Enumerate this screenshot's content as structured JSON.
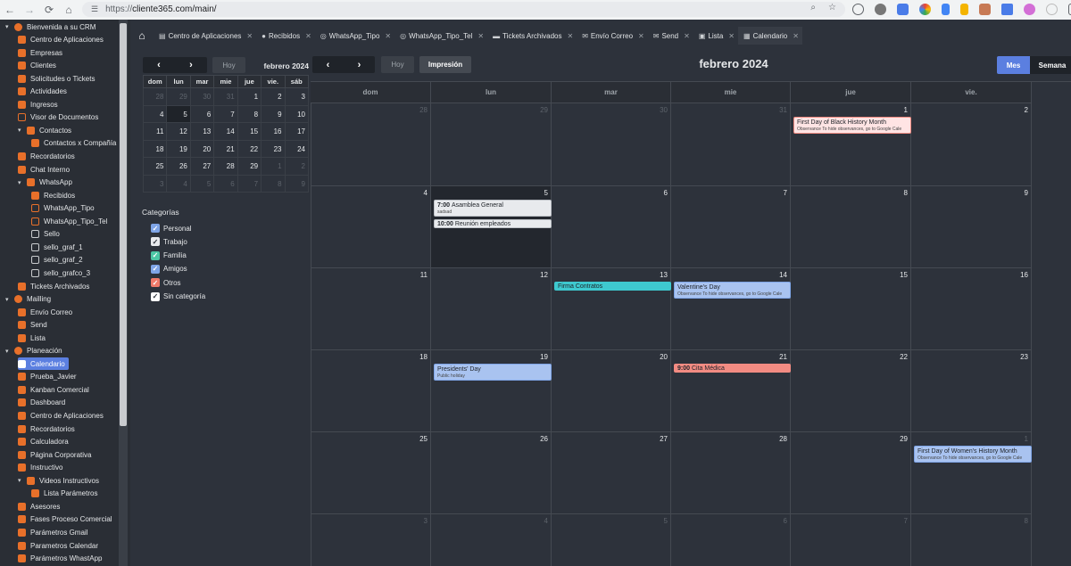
{
  "browser": {
    "url_scheme": "https://",
    "url_host": "cliente365.com/main/"
  },
  "sidebar": {
    "items": [
      {
        "label": "Bienvenida a su CRM",
        "level": 0,
        "icon": "shield-icon",
        "caret": "▾"
      },
      {
        "label": "Centro de Aplicaciones",
        "level": 1,
        "icon": "apps-icon"
      },
      {
        "label": "Empresas",
        "level": 1,
        "icon": "building-icon"
      },
      {
        "label": "Clientes",
        "level": 1,
        "icon": "users-icon"
      },
      {
        "label": "Solicitudes o Tickets",
        "level": 1,
        "icon": "ticket-icon"
      },
      {
        "label": "Actividades",
        "level": 1,
        "icon": "activity-icon"
      },
      {
        "label": "Ingresos",
        "level": 1,
        "icon": "income-icon"
      },
      {
        "label": "Visor de Documentos",
        "level": 1,
        "icon": "document-icon"
      },
      {
        "label": "Contactos",
        "level": 1,
        "icon": "contacts-icon",
        "caret": "▾"
      },
      {
        "label": "Contactos x Compañía",
        "level": 2,
        "icon": "contacts-icon"
      },
      {
        "label": "Recordatorios",
        "level": 1,
        "icon": "reminder-icon"
      },
      {
        "label": "Chat Interno",
        "level": 1,
        "icon": "chat-icon"
      },
      {
        "label": "WhatsApp",
        "level": 1,
        "icon": "whatsapp-icon",
        "caret": "▾"
      },
      {
        "label": "Recibidos",
        "level": 2,
        "icon": "inbox-icon"
      },
      {
        "label": "WhatsApp_Tipo",
        "level": 2,
        "icon": "form-icon"
      },
      {
        "label": "WhatsApp_Tipo_Tel",
        "level": 2,
        "icon": "form-icon"
      },
      {
        "label": "Sello",
        "level": 2,
        "icon": "stamp-icon"
      },
      {
        "label": "sello_graf_1",
        "level": 2,
        "icon": "file-icon"
      },
      {
        "label": "sello_graf_2",
        "level": 2,
        "icon": "file-icon"
      },
      {
        "label": "sello_grafco_3",
        "level": 2,
        "icon": "file-icon"
      },
      {
        "label": "Tickets Archivados",
        "level": 1,
        "icon": "archive-icon"
      },
      {
        "label": "Mailling",
        "level": 0,
        "icon": "mail-icon",
        "caret": "▾"
      },
      {
        "label": "Envío Correo",
        "level": 1,
        "icon": "envelope-icon"
      },
      {
        "label": "Send",
        "level": 1,
        "icon": "send-icon"
      },
      {
        "label": "Lista",
        "level": 1,
        "icon": "list-icon"
      },
      {
        "label": "Planeación",
        "level": 0,
        "icon": "chart-icon",
        "caret": "▾"
      },
      {
        "label": "Calendario",
        "level": 1,
        "icon": "calendar-icon",
        "active": true
      },
      {
        "label": "Prueba_Javier",
        "level": 1,
        "icon": "test-icon"
      },
      {
        "label": "Kanban Comercial",
        "level": 1,
        "icon": "kanban-icon"
      },
      {
        "label": "Dashboard",
        "level": 1,
        "icon": "dashboard-icon"
      },
      {
        "label": "Centro de Aplicaciones",
        "level": 1,
        "icon": "apps-icon"
      },
      {
        "label": "Recordatorios",
        "level": 1,
        "icon": "reminder-icon"
      },
      {
        "label": "Calculadora",
        "level": 1,
        "icon": "calculator-icon"
      },
      {
        "label": "Página Corporativa",
        "level": 1,
        "icon": "web-icon"
      },
      {
        "label": "Instructivo",
        "level": 1,
        "icon": "help-icon"
      },
      {
        "label": "Videos Instructivos",
        "level": 1,
        "icon": "video-icon",
        "caret": "▾"
      },
      {
        "label": "Lista Parámetros",
        "level": 2,
        "icon": "checklist-icon"
      },
      {
        "label": "Asesores",
        "level": 1,
        "icon": "advisor-icon"
      },
      {
        "label": "Fases Proceso Comercial",
        "level": 1,
        "icon": "phases-icon"
      },
      {
        "label": "Parámetros Gmail",
        "level": 1,
        "icon": "gmail-icon"
      },
      {
        "label": "Parametros Calendar",
        "level": 1,
        "icon": "calendar-settings-icon"
      },
      {
        "label": "Parámetros WhastApp",
        "level": 1,
        "icon": "whatsapp-settings-icon"
      }
    ]
  },
  "tabs": [
    {
      "label": "Centro de Aplicaciones",
      "icon": "▤"
    },
    {
      "label": "Recibidos",
      "icon": "●"
    },
    {
      "label": "WhatsApp_Tipo",
      "icon": "◎"
    },
    {
      "label": "WhatsApp_Tipo_Tel",
      "icon": "◎"
    },
    {
      "label": "Tickets Archivados",
      "icon": "▬"
    },
    {
      "label": "Envío Correo",
      "icon": "✉"
    },
    {
      "label": "Send",
      "icon": "✉"
    },
    {
      "label": "Lista",
      "icon": "▣"
    },
    {
      "label": "Calendario",
      "icon": "▦",
      "active": true
    }
  ],
  "mini_calendar": {
    "today_label": "Hoy",
    "title": "febrero 2024",
    "headers": [
      "dom",
      "lun",
      "mar",
      "mie",
      "jue",
      "vie.",
      "sáb"
    ],
    "weeks": [
      [
        [
          "28",
          1
        ],
        [
          "29",
          1
        ],
        [
          "30",
          1
        ],
        [
          "31",
          1
        ],
        [
          "1",
          0
        ],
        [
          "2",
          0
        ],
        [
          "3",
          0
        ]
      ],
      [
        [
          "4",
          0
        ],
        [
          "5",
          2
        ],
        [
          "6",
          0
        ],
        [
          "7",
          0
        ],
        [
          "8",
          0
        ],
        [
          "9",
          0
        ],
        [
          "10",
          0
        ]
      ],
      [
        [
          "11",
          0
        ],
        [
          "12",
          0
        ],
        [
          "13",
          0
        ],
        [
          "14",
          0
        ],
        [
          "15",
          0
        ],
        [
          "16",
          0
        ],
        [
          "17",
          0
        ]
      ],
      [
        [
          "18",
          0
        ],
        [
          "19",
          0
        ],
        [
          "20",
          0
        ],
        [
          "21",
          0
        ],
        [
          "22",
          0
        ],
        [
          "23",
          0
        ],
        [
          "24",
          0
        ]
      ],
      [
        [
          "25",
          0
        ],
        [
          "26",
          0
        ],
        [
          "27",
          0
        ],
        [
          "28",
          0
        ],
        [
          "29",
          0
        ],
        [
          "1",
          1
        ],
        [
          "2",
          1
        ]
      ],
      [
        [
          "3",
          1
        ],
        [
          "4",
          1
        ],
        [
          "5",
          1
        ],
        [
          "6",
          1
        ],
        [
          "7",
          1
        ],
        [
          "8",
          1
        ],
        [
          "9",
          1
        ]
      ]
    ]
  },
  "categories": {
    "title": "Categorías",
    "items": [
      {
        "label": "Personal",
        "color": "#7ea4e6"
      },
      {
        "label": "Trabajo",
        "color": "#e8eaed"
      },
      {
        "label": "Familia",
        "color": "#4cc7a4"
      },
      {
        "label": "Amigos",
        "color": "#7ea4e6"
      },
      {
        "label": "Otros",
        "color": "#f07a6a"
      },
      {
        "label": "Sin categoría",
        "color": "#ffffff"
      }
    ]
  },
  "calendar": {
    "today_label": "Hoy",
    "print_label": "Impresión",
    "title": "febrero 2024",
    "view_month": "Mes",
    "view_week": "Semana",
    "headers": [
      "dom",
      "lun",
      "mar",
      "mie",
      "jue",
      "vie."
    ],
    "weeks": [
      [
        [
          "28",
          1
        ],
        [
          "29",
          1
        ],
        [
          "30",
          1
        ],
        [
          "31",
          1
        ],
        [
          "1",
          0
        ],
        [
          "2",
          0
        ]
      ],
      [
        [
          "4",
          0
        ],
        [
          "5",
          2
        ],
        [
          "6",
          0
        ],
        [
          "7",
          0
        ],
        [
          "8",
          0
        ],
        [
          "9",
          0
        ]
      ],
      [
        [
          "11",
          0
        ],
        [
          "12",
          0
        ],
        [
          "13",
          0
        ],
        [
          "14",
          0
        ],
        [
          "15",
          0
        ],
        [
          "16",
          0
        ]
      ],
      [
        [
          "18",
          0
        ],
        [
          "19",
          0
        ],
        [
          "20",
          0
        ],
        [
          "21",
          0
        ],
        [
          "22",
          0
        ],
        [
          "23",
          0
        ]
      ],
      [
        [
          "25",
          0
        ],
        [
          "26",
          0
        ],
        [
          "27",
          0
        ],
        [
          "28",
          0
        ],
        [
          "29",
          0
        ],
        [
          "1",
          1
        ]
      ],
      [
        [
          "3",
          1
        ],
        [
          "4",
          1
        ],
        [
          "5",
          1
        ],
        [
          "6",
          1
        ],
        [
          "7",
          1
        ],
        [
          "8",
          1
        ]
      ]
    ],
    "events": [
      {
        "week": 0,
        "day": 4,
        "slot": 0,
        "time": "",
        "title": "First Day of Black History Month",
        "sub": "Observance To hide observances, go to Google Cale",
        "bg": "#ffe4e4",
        "border": "#f28b82"
      },
      {
        "week": 1,
        "day": 1,
        "slot": 0,
        "time": "7:00",
        "title": "Asamblea General",
        "sub": "sadsad",
        "bg": "#e8eaed",
        "border": "#bdc1c6"
      },
      {
        "week": 1,
        "day": 1,
        "slot": 1,
        "time": "10:00",
        "title": "Reunión empleados",
        "sub": "",
        "bg": "#e8eaed",
        "border": "#bdc1c6"
      },
      {
        "week": 2,
        "day": 2,
        "slot": 0,
        "time": "",
        "title": "Firma Contratos",
        "sub": "",
        "bg": "#3ec9cf",
        "border": "#3ec9cf"
      },
      {
        "week": 2,
        "day": 3,
        "slot": 0,
        "time": "",
        "title": "Valentine's Day",
        "sub": "Observance To hide observances, go to Google Cale",
        "bg": "#a9c3f0",
        "border": "#7ea4e6"
      },
      {
        "week": 3,
        "day": 1,
        "slot": 0,
        "time": "",
        "title": "Presidents' Day",
        "sub": "Public holiday",
        "bg": "#a9c3f0",
        "border": "#7ea4e6"
      },
      {
        "week": 3,
        "day": 3,
        "slot": 0,
        "time": "9:00",
        "title": "Cita Médica",
        "sub": "",
        "bg": "#f28b82",
        "border": "#f28b82"
      },
      {
        "week": 4,
        "day": 5,
        "slot": 0,
        "time": "",
        "title": "First Day of Women's History Month",
        "sub": "Observance To hide observances, go to Google Cale",
        "bg": "#a9c3f0",
        "border": "#7ea4e6"
      }
    ]
  }
}
